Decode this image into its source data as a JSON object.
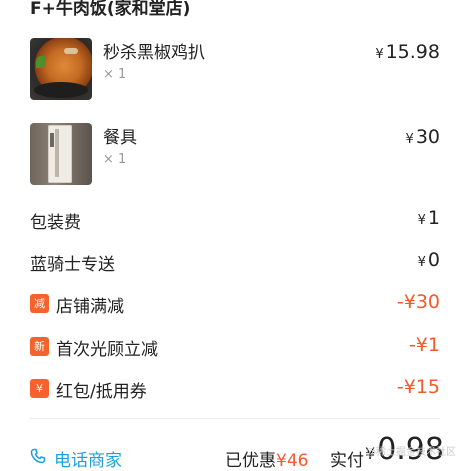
{
  "shop": {
    "name": "F+牛肉饭(家和堂店)"
  },
  "currency_symbol": "¥",
  "items": [
    {
      "name": "秒杀黑椒鸡扒",
      "qty": "× 1",
      "price": "15.98",
      "image": "black-pepper-chicken-steak-photo"
    },
    {
      "name": "餐具",
      "qty": "× 1",
      "price": "30",
      "image": "utensil-pack-photo"
    }
  ],
  "fees": {
    "packaging": {
      "label": "包装费",
      "value": "1"
    },
    "delivery": {
      "label": "蓝骑士专送",
      "value": "0"
    }
  },
  "discounts": [
    {
      "badge": "减",
      "label": "店铺满减",
      "value": "-¥30"
    },
    {
      "badge": "新",
      "label": "首次光顾立减",
      "value": "-¥1"
    },
    {
      "badge": "¥",
      "label": "红包/抵用券",
      "value": "-¥15"
    }
  ],
  "footer": {
    "call_label": "电话商家",
    "saved_label": "已优惠",
    "saved_amount": "¥46",
    "paid_label": "实付",
    "paid_amount": "0.98"
  },
  "watermark": "@稀土掘金技术社区",
  "colors": {
    "accent": "#f35a2b",
    "badge": "#f5622c",
    "link": "#1f9fe0",
    "text": "#222222",
    "muted": "#999999"
  }
}
